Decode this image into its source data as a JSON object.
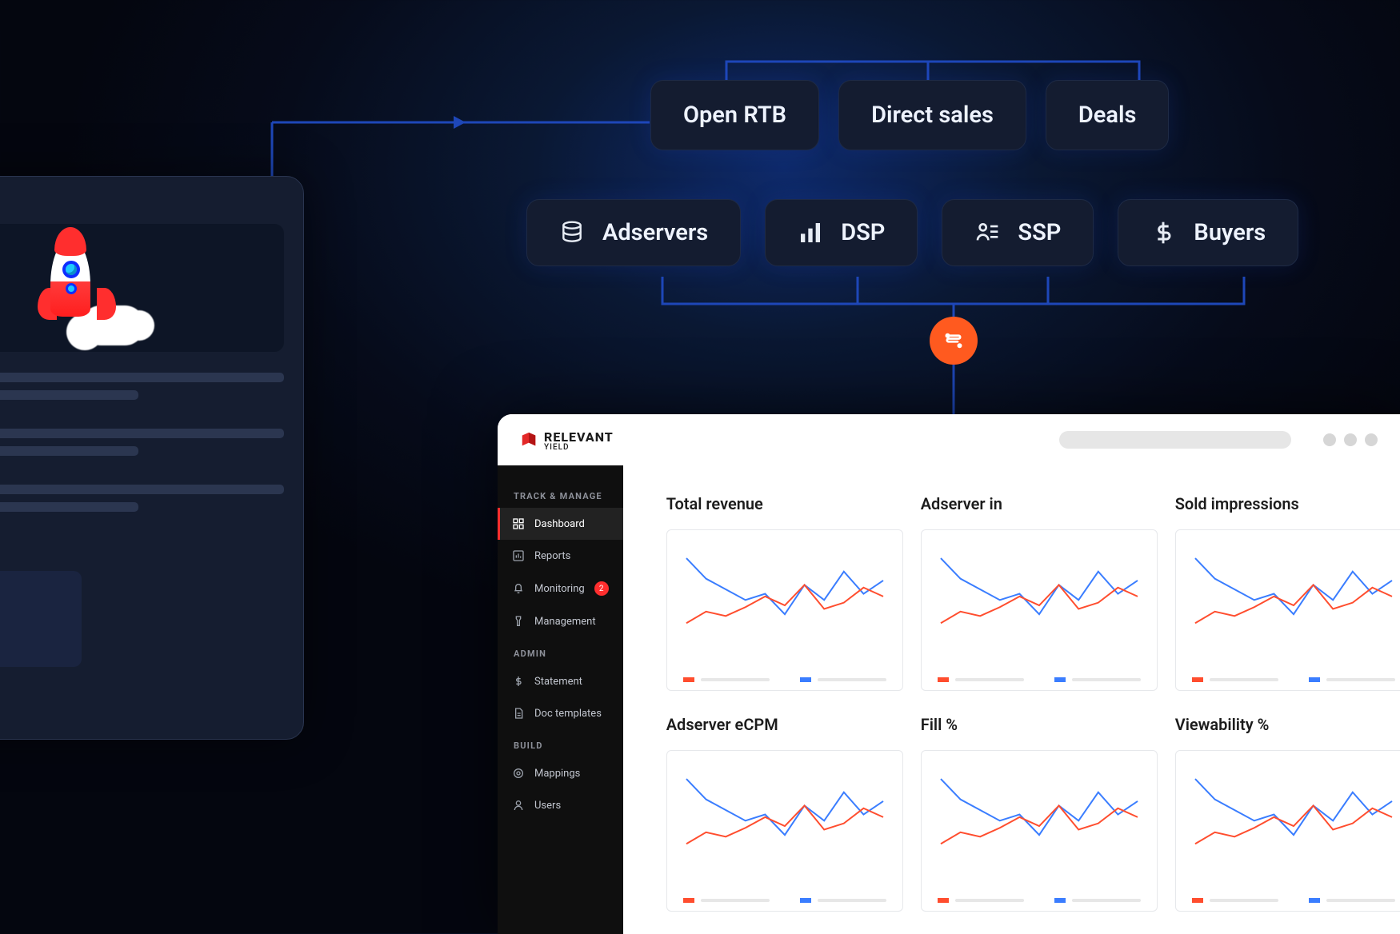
{
  "diagram": {
    "top_row": [
      "Open RTB",
      "Direct sales",
      "Deals"
    ],
    "mid_row": [
      {
        "icon": "database",
        "label": "Adservers"
      },
      {
        "icon": "bars",
        "label": "DSP"
      },
      {
        "icon": "person-list",
        "label": "SSP"
      },
      {
        "icon": "dollar",
        "label": "Buyers"
      }
    ]
  },
  "dashboard": {
    "brand": {
      "main": "RELEVANT",
      "sub": "YIELD"
    },
    "sidebar": {
      "sections": [
        {
          "title": "TRACK & MANAGE",
          "items": [
            {
              "icon": "grid",
              "label": "Dashboard",
              "active": true
            },
            {
              "icon": "chart",
              "label": "Reports"
            },
            {
              "icon": "bell",
              "label": "Monitoring",
              "badge": "2"
            },
            {
              "icon": "filter",
              "label": "Management"
            }
          ]
        },
        {
          "title": "ADMIN",
          "items": [
            {
              "icon": "dollar",
              "label": "Statement"
            },
            {
              "icon": "doc",
              "label": "Doc templates"
            }
          ]
        },
        {
          "title": "BUILD",
          "items": [
            {
              "icon": "target",
              "label": "Mappings"
            },
            {
              "icon": "user",
              "label": "Users"
            }
          ]
        }
      ]
    },
    "cards": [
      "Total revenue",
      "Adserver in",
      "Sold impressions",
      "Adserver eCPM",
      "Fill %",
      "Viewability %"
    ]
  },
  "chart_data": {
    "type": "line",
    "note": "identical two-line spark chart shown in all 6 cards; values inferred from pixel heights (0–100 scale)",
    "x": [
      0,
      1,
      2,
      3,
      4,
      5,
      6,
      7,
      8,
      9,
      10
    ],
    "series": [
      {
        "name": "blue",
        "color": "#3a7dff",
        "values": [
          85,
          62,
          50,
          38,
          45,
          22,
          55,
          38,
          70,
          45,
          60
        ]
      },
      {
        "name": "red",
        "color": "#ff4d2e",
        "values": [
          12,
          25,
          20,
          30,
          42,
          32,
          55,
          28,
          35,
          52,
          42
        ]
      }
    ],
    "ylim": [
      0,
      100
    ]
  }
}
